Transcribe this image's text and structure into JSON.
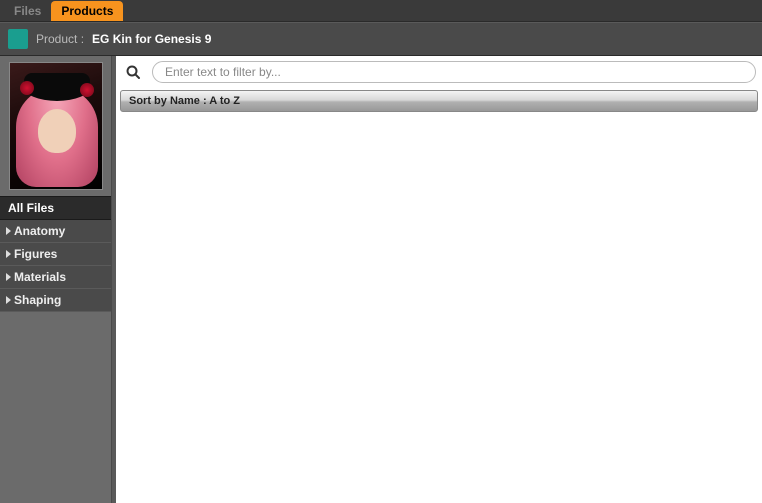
{
  "tabs": {
    "files": "Files",
    "products": "Products"
  },
  "header": {
    "label": "Product :",
    "name": "EG Kin for Genesis 9"
  },
  "sidebar": {
    "root": "All Files",
    "items": [
      {
        "label": "Anatomy"
      },
      {
        "label": "Figures"
      },
      {
        "label": "Materials"
      },
      {
        "label": "Shaping"
      }
    ]
  },
  "filter": {
    "placeholder": "Enter text to filter by..."
  },
  "sort": {
    "label": "Sort by Name : A to Z"
  }
}
